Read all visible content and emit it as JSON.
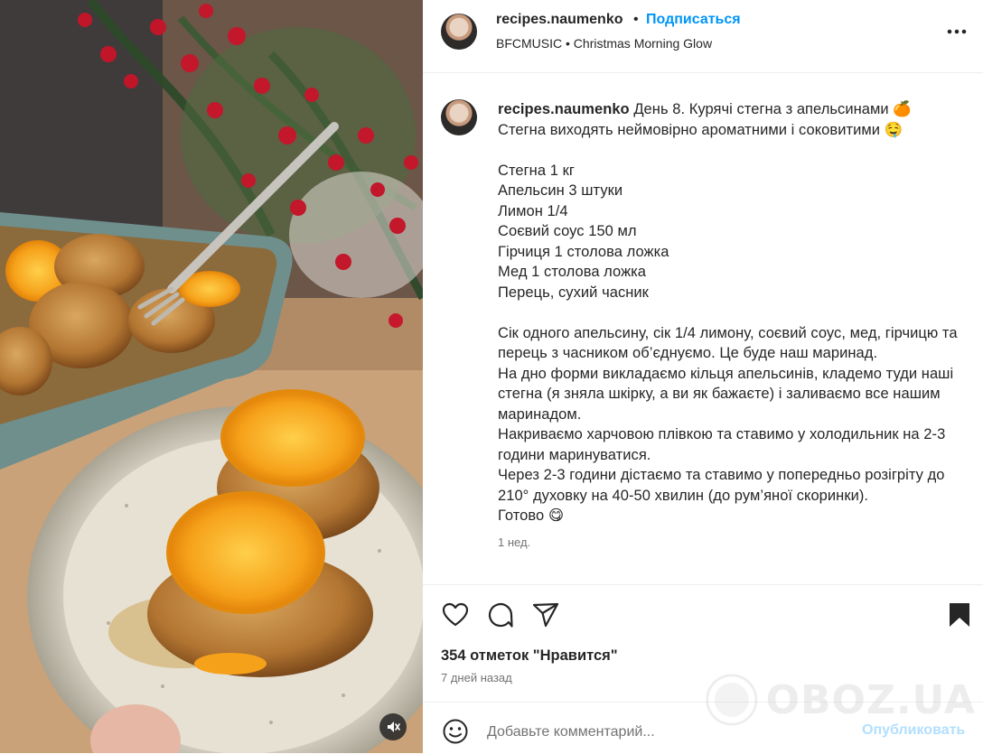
{
  "header": {
    "username": "recipes.naumenko",
    "separator": "•",
    "follow_label": "Подписаться",
    "music": "BFCMUSIC • Christmas Morning Glow",
    "more_icon": "more-horizontal-icon"
  },
  "caption": {
    "username": "recipes.naumenko",
    "text": " День 8. Курячі стегна з апельсинами 🍊\nСтегна виходять неймовірно ароматними і соковитими 🤤\n\nСтегна 1 кг\nАпельсин 3 штуки\nЛимон 1/4\nСоєвий соус 150 мл\nГірчиця 1 столова ложка\nМед 1 столова ложка\nПерець, сухий часник\n\nСік одного апельсину, сік 1/4 лимону, соєвий соус, мед, гірчицю та перець з часником об’єднуємо. Це буде наш маринад.\nНа дно форми викладаємо кільця апельсинів, кладемо туди наші стегна (я зняла шкірку, а ви як бажаєте) і заливаємо все нашим маринадом.\nНакриваємо харчовою плівкою та ставимо у холодильник на 2-3 години маринуватися.\nЧерез 2-3 години дістаємо та ставимо у попередньо розігріту до 210° духовку на 40-50 хвилин (до рум’яної скоринки).\nГотово 😋",
    "time_ago": "1 нед."
  },
  "actions": {
    "likes": "354 отметок \"Нравится\"",
    "date": "7 дней назад",
    "icons": [
      "heart-icon",
      "comment-icon",
      "share-icon",
      "bookmark-icon"
    ]
  },
  "comment": {
    "placeholder": "Добавьте комментарий...",
    "post_label": "Опубликовать"
  },
  "watermark": {
    "text": "OBOZ.UA"
  },
  "colors": {
    "link": "#0095f6",
    "post_disabled": "#b2dffc",
    "muted": "#737373",
    "text": "#262626"
  }
}
